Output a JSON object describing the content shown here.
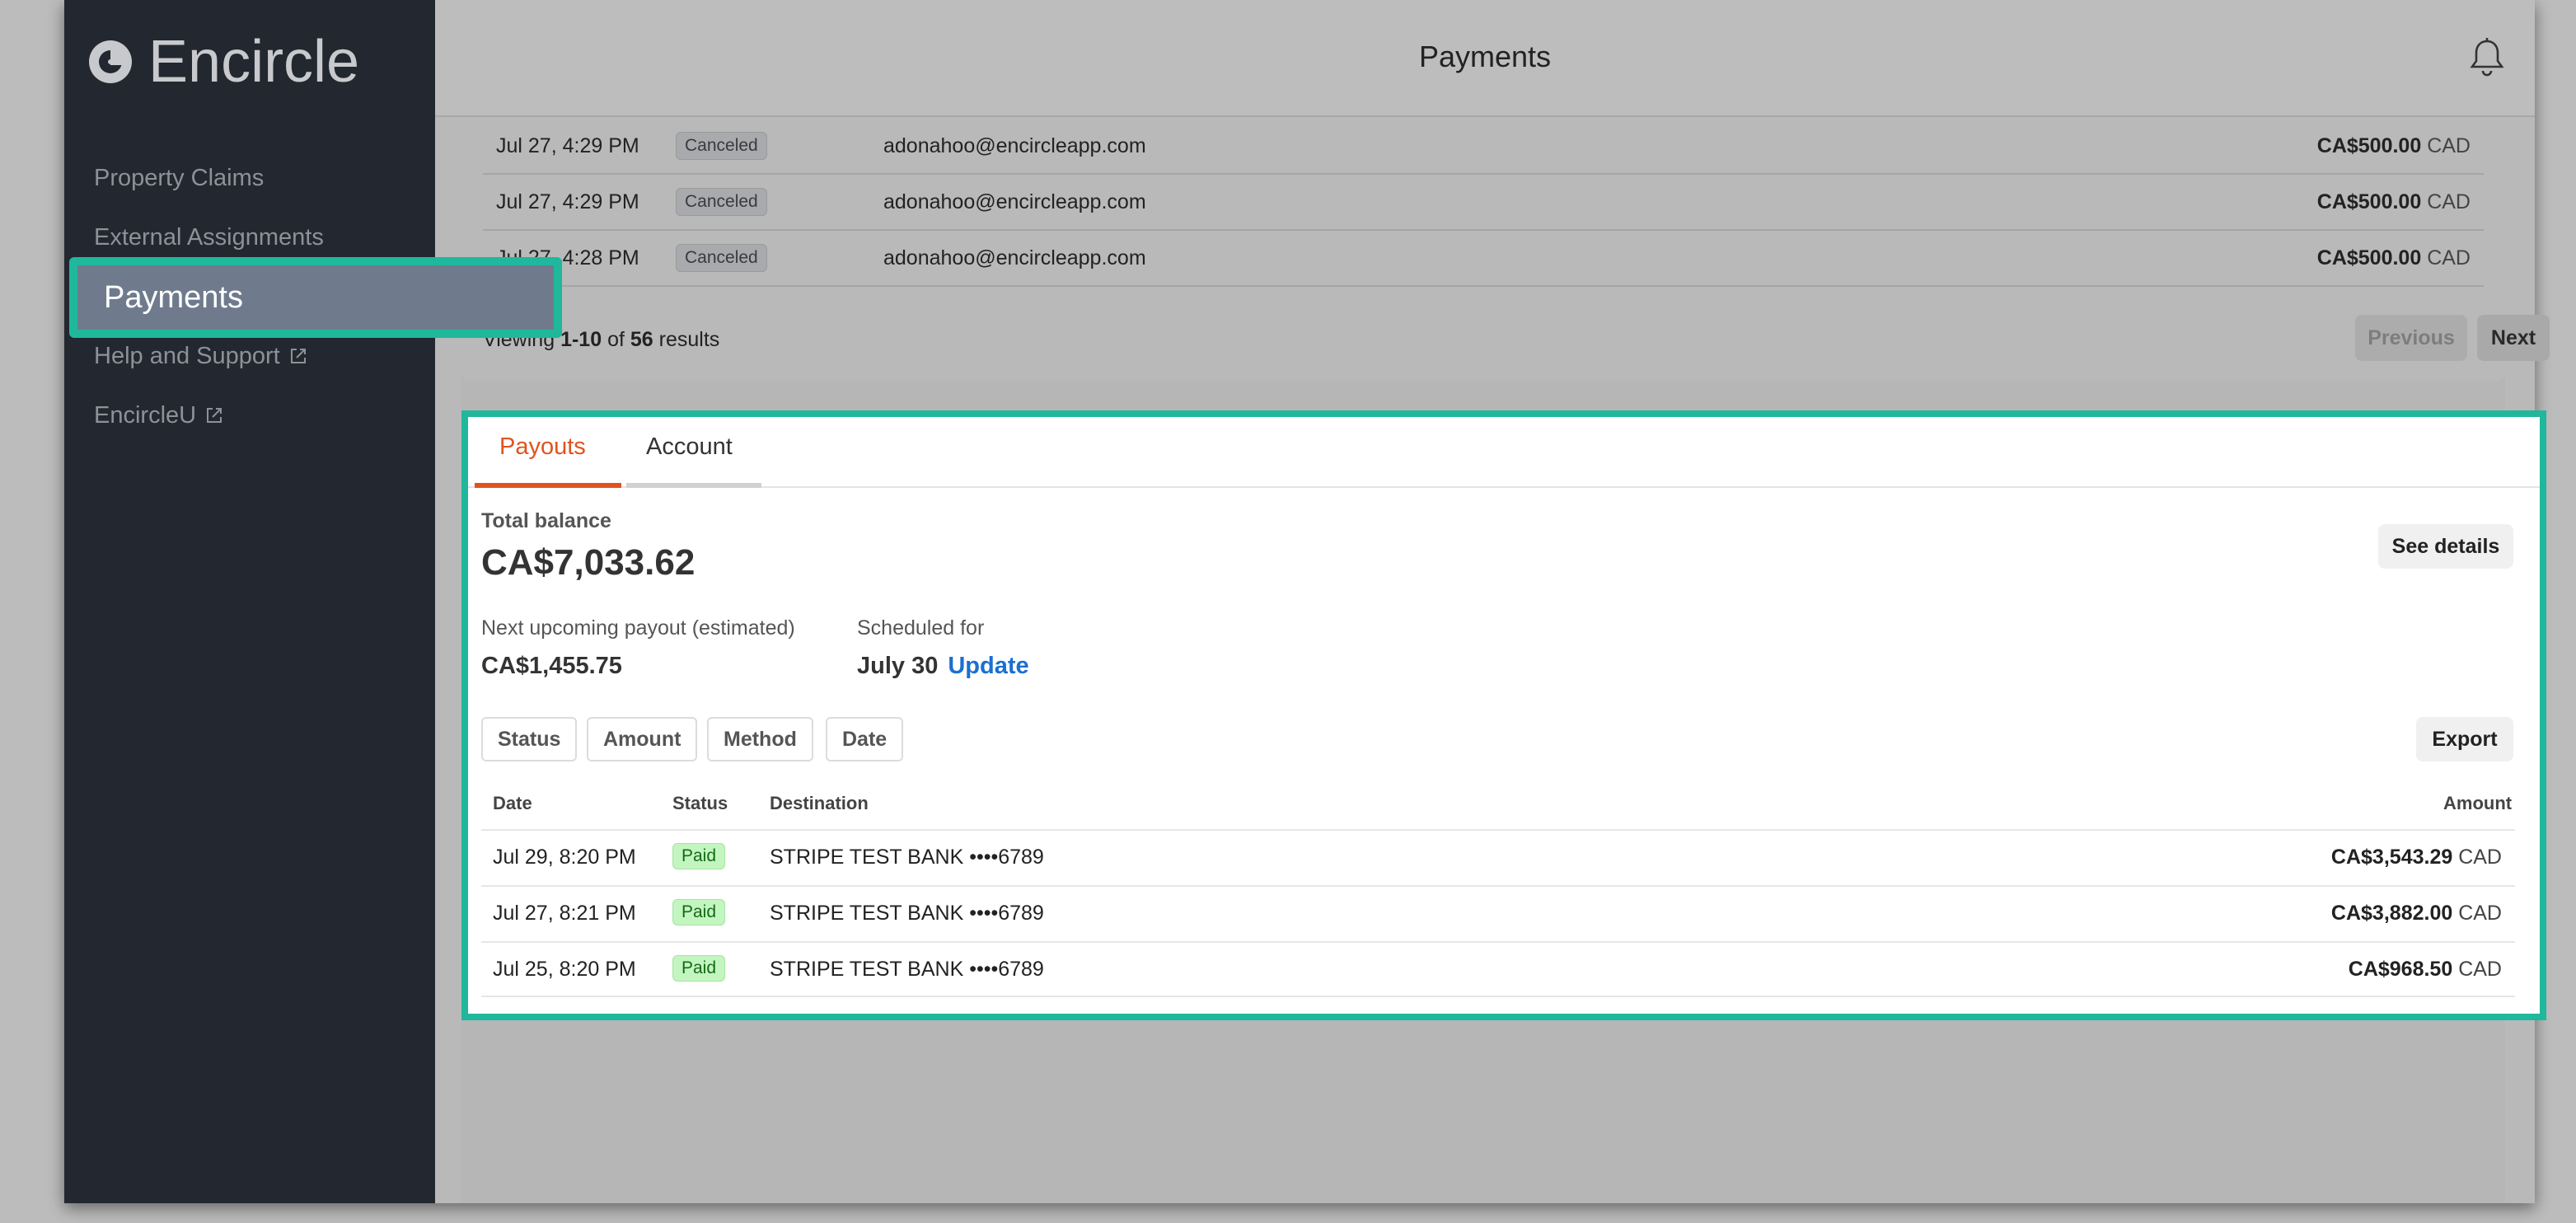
{
  "app": {
    "logo_text": "Encircle",
    "page_title": "Payments"
  },
  "sidebar": {
    "items": [
      {
        "label": "Property Claims"
      },
      {
        "label": "External Assignments"
      },
      {
        "label": "Payments"
      },
      {
        "label": "Help and Support"
      },
      {
        "label": "EncircleU"
      }
    ]
  },
  "payments_table": {
    "rows": [
      {
        "date": "Jul 27, 4:29 PM",
        "status": "Canceled",
        "email": "adonahoo@encircleapp.com",
        "amount": "CA$500.00",
        "currency": "CAD"
      },
      {
        "date": "Jul 27, 4:29 PM",
        "status": "Canceled",
        "email": "adonahoo@encircleapp.com",
        "amount": "CA$500.00",
        "currency": "CAD"
      },
      {
        "date": "Jul 27, 4:28 PM",
        "status": "Canceled",
        "email": "adonahoo@encircleapp.com",
        "amount": "CA$500.00",
        "currency": "CAD"
      }
    ],
    "pagination": {
      "viewing_prefix": "Viewing",
      "range": "1-10",
      "of": "of",
      "total": "56",
      "suffix": "results",
      "previous_label": "Previous",
      "next_label": "Next"
    }
  },
  "payouts": {
    "tabs": [
      {
        "label": "Payouts"
      },
      {
        "label": "Account"
      }
    ],
    "total_balance_label": "Total balance",
    "total_balance": "CA$7,033.62",
    "see_details_label": "See details",
    "next_payout_label": "Next upcoming payout (estimated)",
    "next_payout_value": "CA$1,455.75",
    "scheduled_label": "Scheduled for",
    "scheduled_value": "July 30",
    "update_label": "Update",
    "filters": [
      {
        "label": "Status"
      },
      {
        "label": "Amount"
      },
      {
        "label": "Method"
      },
      {
        "label": "Date"
      }
    ],
    "export_label": "Export",
    "columns": {
      "date": "Date",
      "status": "Status",
      "destination": "Destination",
      "amount": "Amount"
    },
    "rows": [
      {
        "date": "Jul 29, 8:20 PM",
        "status": "Paid",
        "destination": "STRIPE TEST BANK ••••6789",
        "amount": "CA$3,543.29",
        "currency": "CAD"
      },
      {
        "date": "Jul 27, 8:21 PM",
        "status": "Paid",
        "destination": "STRIPE TEST BANK ••••6789",
        "amount": "CA$3,882.00",
        "currency": "CAD"
      },
      {
        "date": "Jul 25, 8:20 PM",
        "status": "Paid",
        "destination": "STRIPE TEST BANK ••••6789",
        "amount": "CA$968.50",
        "currency": "CAD"
      }
    ]
  },
  "colors": {
    "highlight": "#1fb89c",
    "accent": "#e0531f",
    "link": "#1a6fd1"
  }
}
